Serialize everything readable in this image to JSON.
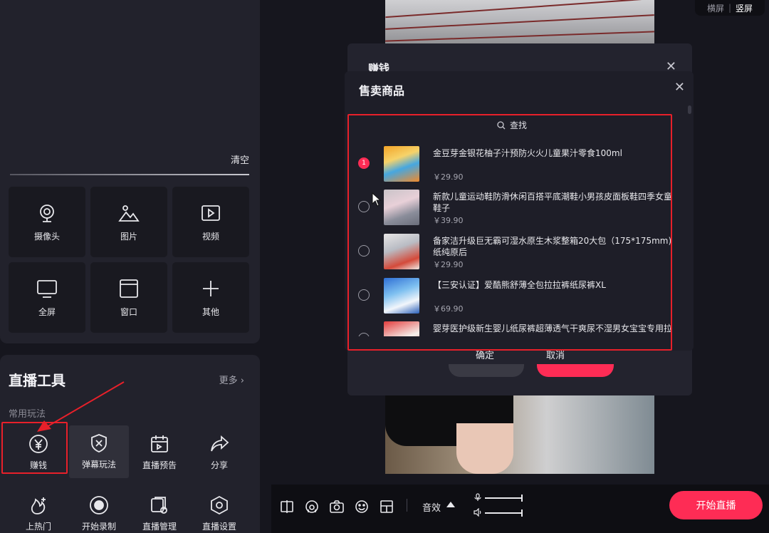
{
  "source_panel": {
    "clear_label": "清空",
    "sources": [
      {
        "label": "摄像头",
        "icon": "camera-icon"
      },
      {
        "label": "图片",
        "icon": "image-icon"
      },
      {
        "label": "视频",
        "icon": "video-icon"
      },
      {
        "label": "全屏",
        "icon": "monitor-icon"
      },
      {
        "label": "窗口",
        "icon": "window-icon"
      },
      {
        "label": "其他",
        "icon": "plus-icon"
      }
    ]
  },
  "tools_panel": {
    "title": "直播工具",
    "more_label": "更多 ›",
    "section_label": "常用玩法",
    "tools": [
      {
        "label": "赚钱",
        "icon": "yen-icon"
      },
      {
        "label": "弹幕玩法",
        "icon": "danmu-icon"
      },
      {
        "label": "直播预告",
        "icon": "calendar-icon"
      },
      {
        "label": "分享",
        "icon": "share-icon"
      },
      {
        "label": "上热门",
        "icon": "fire-icon"
      },
      {
        "label": "开始录制",
        "icon": "record-icon"
      },
      {
        "label": "直播管理",
        "icon": "manage-icon"
      },
      {
        "label": "直播设置",
        "icon": "settings-icon"
      }
    ]
  },
  "orientation": {
    "landscape": "横屏",
    "separator": "|",
    "portrait": "竖屏"
  },
  "earn_dialog": {
    "title": "赚钱",
    "confirm_label": "确定",
    "cancel_label": "取消"
  },
  "goods_dialog": {
    "title": "售卖商品",
    "search_label": "查找",
    "products": [
      {
        "name": "金豆芽金银花柚子汁预防火火儿童果汁零食100ml",
        "price": "￥29.90",
        "selected": true,
        "badge": "1"
      },
      {
        "name": "新款儿童运动鞋防滑休闲百搭平底潮鞋小男孩皮面板鞋四季女童鞋子",
        "price": "￥39.90",
        "selected": false
      },
      {
        "name": "备家洁升级巨无霸可湿水原生木浆整箱20大包（175*175mm)纸纯原后",
        "price": "￥29.90",
        "selected": false
      },
      {
        "name": "【三安认证】爱酷熊舒薄全包拉拉裤纸尿裤XL",
        "price": "￥69.90",
        "selected": false
      },
      {
        "name": "婴芽医护级新生婴儿纸尿裤超薄透气干爽尿不湿男女宝宝专用拉",
        "price": "",
        "selected": false
      }
    ]
  },
  "toolbar": {
    "sound_label": "音效",
    "start_label": "开始直播"
  },
  "colors": {
    "accent": "#fe2c55",
    "highlight": "#e8202a",
    "panel": "#22222c"
  }
}
